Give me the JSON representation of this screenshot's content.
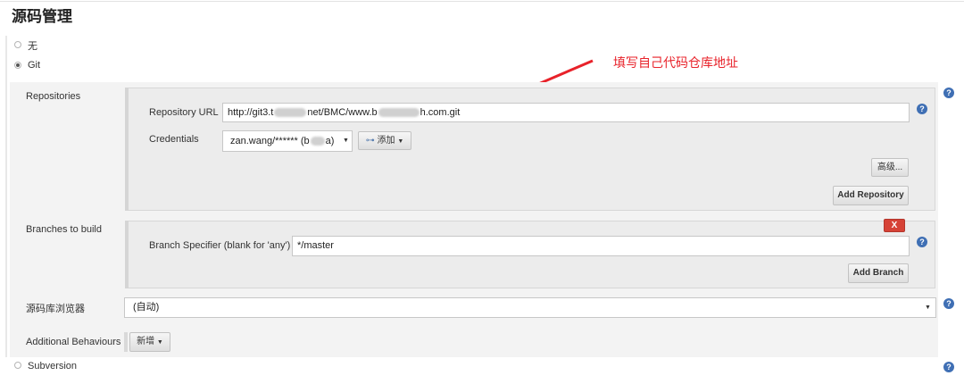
{
  "section": {
    "title": "源码管理"
  },
  "scm_options": [
    {
      "label": "无",
      "selected": false
    },
    {
      "label": "Git",
      "selected": true
    },
    {
      "label": "Subversion",
      "selected": false
    }
  ],
  "annotation": {
    "text": "填写自己代码仓库地址",
    "color": "#e8222a"
  },
  "repositories": {
    "label": "Repositories",
    "url_label": "Repository URL",
    "url_parts": [
      "http://git3.t",
      "net/BMC/www.b",
      "h.com.git"
    ],
    "credentials_label": "Credentials",
    "credentials_parts": [
      "zan.wang/****** (b",
      "a)"
    ],
    "add_button": "添加",
    "advanced_button": "高级...",
    "add_repository_button": "Add Repository"
  },
  "branches": {
    "label": "Branches to build",
    "delete_button": "X",
    "specifier_label": "Branch Specifier (blank for 'any')",
    "specifier_value": "*/master",
    "add_branch_button": "Add Branch"
  },
  "browser": {
    "label": "源码库浏览器",
    "value": "(自动)"
  },
  "behaviours": {
    "label": "Additional Behaviours",
    "add_button": "新增"
  },
  "help_icon": "?"
}
